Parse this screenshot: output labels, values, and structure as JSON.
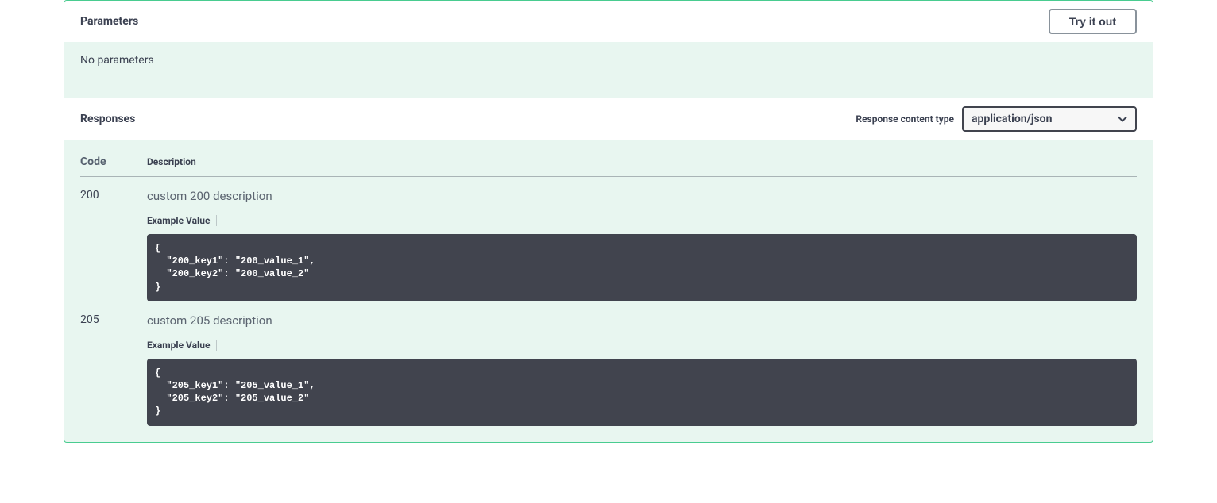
{
  "parameters": {
    "title": "Parameters",
    "try_label": "Try it out",
    "empty_text": "No parameters"
  },
  "responses": {
    "title": "Responses",
    "content_type_label": "Response content type",
    "content_type_value": "application/json",
    "columns": {
      "code": "Code",
      "description": "Description"
    },
    "example_label": "Example Value",
    "items": [
      {
        "code": "200",
        "description": "custom 200 description",
        "example": "{\n  \"200_key1\": \"200_value_1\",\n  \"200_key2\": \"200_value_2\"\n}"
      },
      {
        "code": "205",
        "description": "custom 205 description",
        "example": "{\n  \"205_key1\": \"205_value_1\",\n  \"205_key2\": \"205_value_2\"\n}"
      }
    ]
  }
}
